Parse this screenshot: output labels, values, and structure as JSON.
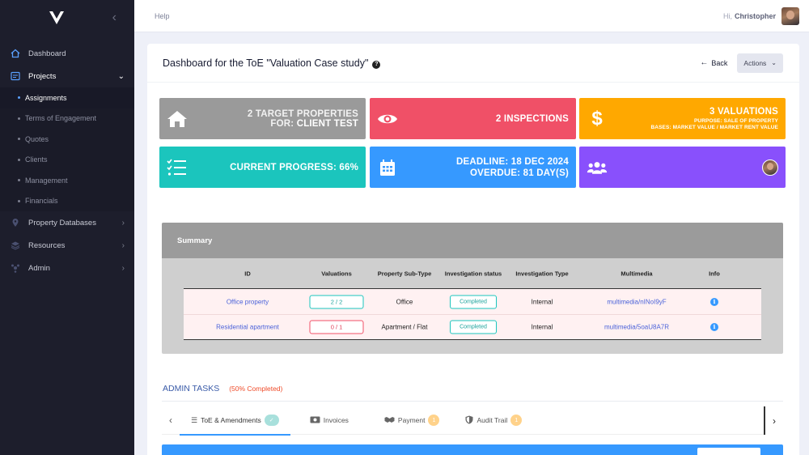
{
  "sidebar": {
    "items": [
      {
        "label": "Dashboard",
        "icon": "home-icon"
      },
      {
        "label": "Projects",
        "icon": "projects-icon"
      },
      {
        "label": "Property Databases",
        "icon": "pin-icon"
      },
      {
        "label": "Resources",
        "icon": "layers-icon"
      },
      {
        "label": "Admin",
        "icon": "admin-icon"
      }
    ],
    "sub_items": [
      "Assignments",
      "Terms of Engagement",
      "Quotes",
      "Clients",
      "Management",
      "Financials"
    ]
  },
  "topbar": {
    "help": "Help",
    "greeting": "Hi,",
    "user_name": "Christopher"
  },
  "header": {
    "title": "Dashboard for the ToE \"Valuation Case study\"",
    "back_label": "Back",
    "actions_label": "Actions"
  },
  "tiles": {
    "target": {
      "line1": "2 Target Properties",
      "line2_prefix": "for:",
      "line2_value": "Client Test"
    },
    "inspections": {
      "label": "2 Inspections"
    },
    "valuations": {
      "label": "3 Valuations",
      "purpose": "Purpose: Sale of property",
      "bases": "Bases: Market Value / Market Rent Value"
    },
    "progress": {
      "label": "Current Progress: 66%"
    },
    "deadline": {
      "line1": "Deadline: 18 Dec 2024",
      "line2": "Overdue: 81 Day(s)"
    }
  },
  "summary": {
    "title": "Summary",
    "columns": [
      "ID",
      "Valuations",
      "Property Sub-Type",
      "Investigation status",
      "Investigation Type",
      "Multimedia",
      "Info"
    ],
    "rows": [
      {
        "id": "Office property",
        "valuations": "2 / 2",
        "sub_type": "Office",
        "status": "Completed",
        "type": "Internal",
        "multimedia": "multimedia/nINoI9yF"
      },
      {
        "id": "Residential apartment",
        "valuations": "0 / 1",
        "sub_type": "Apartment / Flat",
        "status": "Completed",
        "type": "Internal",
        "multimedia": "multimedia/5oaU8A7R"
      }
    ]
  },
  "admin_tasks": {
    "title": "ADMIN TASKS",
    "completed": "(50% Completed)",
    "tabs": [
      {
        "label": "ToE & Amendments",
        "badge": "✓"
      },
      {
        "label": "Invoices",
        "badge": ""
      },
      {
        "label": "Payment",
        "badge": "1"
      },
      {
        "label": "Audit Trail",
        "badge": "1"
      }
    ]
  },
  "colors": {
    "sidebar_bg": "#1d1e2c",
    "tile_gray": "#9a9a9a",
    "tile_red": "#f05067",
    "tile_orange": "#ffa800",
    "tile_teal": "#1bc5bd",
    "tile_blue": "#3699ff",
    "tile_purple": "#8950fc"
  }
}
